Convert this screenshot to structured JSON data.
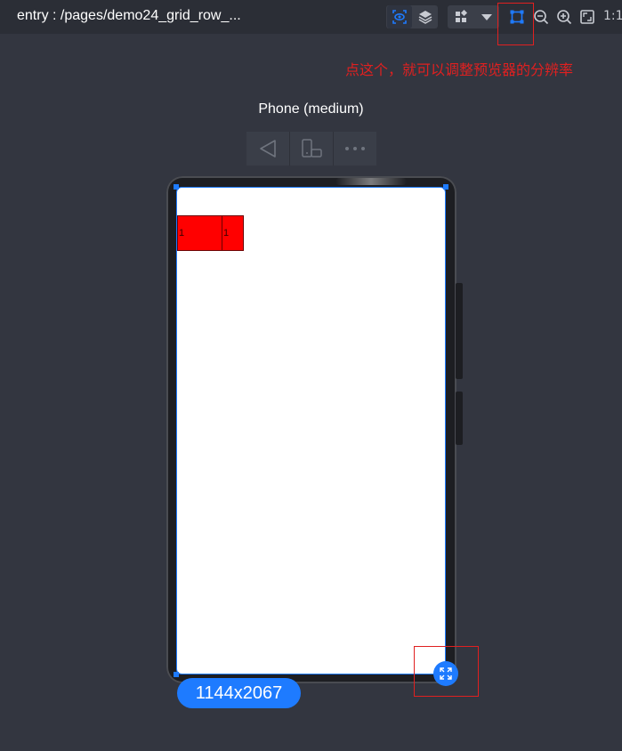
{
  "toolbar": {
    "path_title": "entry : /pages/demo24_grid_row_...",
    "one_to_one_label": "1:1",
    "accent_color": "#1e7bff"
  },
  "annotation": {
    "text": "点这个，就可以调整预览器的分辨率",
    "color": "#e02020"
  },
  "device": {
    "name": "Phone (medium)",
    "controls": [
      "back-icon",
      "rotate-device-icon",
      "more-icon"
    ]
  },
  "preview": {
    "cells": [
      {
        "label": "1",
        "color": "#ff0000"
      },
      {
        "label": "1",
        "color": "#ff0000"
      }
    ],
    "resolution": "1144x2067"
  }
}
